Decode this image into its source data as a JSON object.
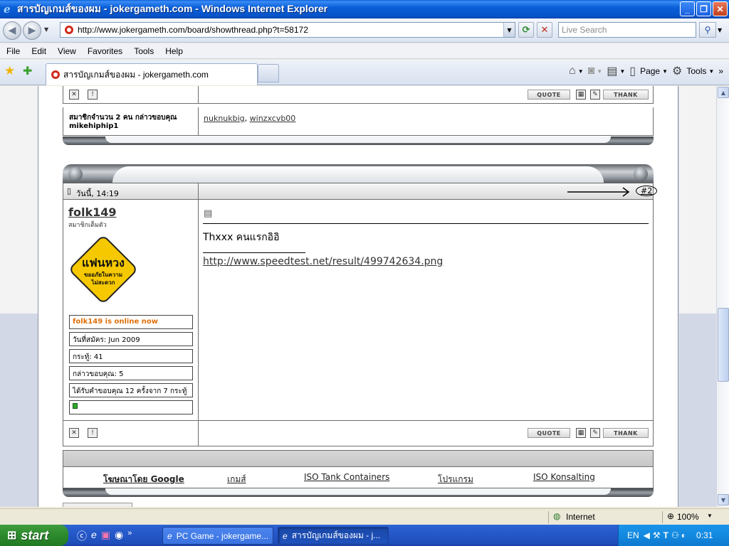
{
  "window": {
    "title": "สารบัญเกมส์ของผม - jokergameth.com - Windows Internet Explorer",
    "min": "_",
    "max": "❐",
    "close": "✕"
  },
  "address": {
    "url": "http://www.jokergameth.com/board/showthread.php?t=58172",
    "search_placeholder": "Live Search"
  },
  "menu": [
    "File",
    "Edit",
    "View",
    "Favorites",
    "Tools",
    "Help"
  ],
  "tab": {
    "label": "สารบัญเกมส์ของผม - jokergameth.com"
  },
  "commandbar": {
    "page": "Page",
    "tools": "Tools"
  },
  "post_prev": {
    "thanks_label": "สมาชิกจำนวน 2 คน กล่าวขอบคุณ",
    "thanks_user": "mikehiphip1",
    "thankers": [
      "nuknukbig",
      "winzxcvb00"
    ],
    "thankers_sep": ",",
    "quote": "QUOTE",
    "thank": "THANK"
  },
  "post": {
    "date": "วันนี้, 14:19",
    "number": "#2",
    "username": "folk149",
    "usertitle": "สมาชิกเต็มตัว",
    "avatar_line1": "แฟนหวง",
    "avatar_line2": "ขออภัยในความ",
    "avatar_line3": "ไม่สะดวก",
    "online": "folk149 is online now",
    "joined": "วันที่สมัคร: Jun 2009",
    "posts": "กระทู้: 41",
    "thanks_given": "กล่าวขอบคุณ: 5",
    "thanks_received": "ได้รับคำขอบคุณ 12 ครั้งจาก 7 กระทู้",
    "message": "Thxxx คนแรกอิอิ",
    "signature_link": "http://www.speedtest.net/result/499742634.png",
    "quote": "QUOTE",
    "thank": "THANK"
  },
  "ads": {
    "items": [
      "โฆษณาโดย Google",
      "เกมส์",
      "ISO Tank Containers",
      "โปรแกรม",
      "ISO Konsalting"
    ]
  },
  "status": {
    "zone": "Internet",
    "zoom": "100%"
  },
  "taskbar": {
    "start": "start",
    "items": [
      "PC Game - jokergame...",
      "สารบัญเกมส์ของผม - j..."
    ],
    "lang": "EN",
    "time": "0:31"
  }
}
